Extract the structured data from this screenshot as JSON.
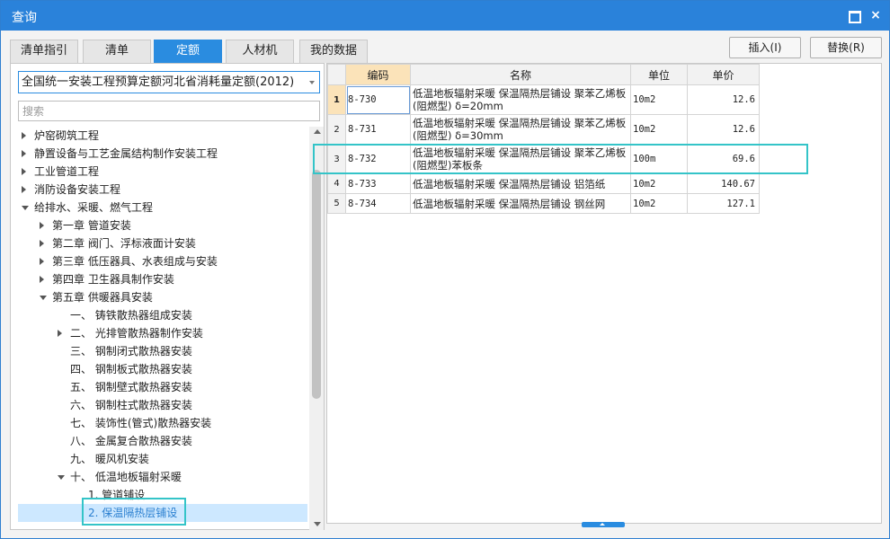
{
  "window": {
    "title": "查询",
    "maximize_icon": "maximize-icon",
    "close_icon": "close-icon",
    "close_glyph": "×"
  },
  "tabs": [
    {
      "label": "清单指引",
      "active": false
    },
    {
      "label": "清单",
      "active": false
    },
    {
      "label": "定额",
      "active": true
    },
    {
      "label": "人材机",
      "active": false
    },
    {
      "label": "我的数据",
      "active": false
    }
  ],
  "buttons": {
    "insert": "插入(I)",
    "replace": "替换(R)"
  },
  "quota_selector": {
    "value": "全国统一安装工程预算定额河北省消耗量定额(2012)"
  },
  "search": {
    "placeholder": "搜索"
  },
  "tree": [
    {
      "label": "炉窑砌筑工程",
      "state": "collapsed",
      "level": 0
    },
    {
      "label": "静置设备与工艺金属结构制作安装工程",
      "state": "collapsed",
      "level": 0
    },
    {
      "label": "工业管道工程",
      "state": "collapsed",
      "level": 0
    },
    {
      "label": "消防设备安装工程",
      "state": "collapsed",
      "level": 0
    },
    {
      "label": "给排水、采暖、燃气工程",
      "state": "expanded",
      "level": 0
    },
    {
      "label": "第一章 管道安装",
      "state": "collapsed",
      "level": 1
    },
    {
      "label": "第二章 阀门、浮标液面计安装",
      "state": "collapsed",
      "level": 1
    },
    {
      "label": "第三章 低压器具、水表组成与安装",
      "state": "collapsed",
      "level": 1
    },
    {
      "label": "第四章 卫生器具制作安装",
      "state": "collapsed",
      "level": 1
    },
    {
      "label": "第五章 供暖器具安装",
      "state": "expanded",
      "level": 1
    },
    {
      "label": "一、 铸铁散热器组成安装",
      "state": "leaf",
      "level": 2
    },
    {
      "label": "二、 光排管散热器制作安装",
      "state": "collapsed",
      "level": 2
    },
    {
      "label": "三、 钢制闭式散热器安装",
      "state": "leaf",
      "level": 2
    },
    {
      "label": "四、 钢制板式散热器安装",
      "state": "leaf",
      "level": 2
    },
    {
      "label": "五、 钢制壁式散热器安装",
      "state": "leaf",
      "level": 2
    },
    {
      "label": "六、 钢制柱式散热器安装",
      "state": "leaf",
      "level": 2
    },
    {
      "label": "七、 装饰性(管式)散热器安装",
      "state": "leaf",
      "level": 2
    },
    {
      "label": "八、 金属复合散热器安装",
      "state": "leaf",
      "level": 2
    },
    {
      "label": "九、 暖风机安装",
      "state": "leaf",
      "level": 2
    },
    {
      "label": "十、 低温地板辐射采暖",
      "state": "expanded",
      "level": 2
    },
    {
      "label": "1. 管道铺设",
      "state": "leaf",
      "level": 3
    },
    {
      "label": "2. 保温隔热层铺设",
      "state": "leaf",
      "level": 3,
      "selected": true
    }
  ],
  "table": {
    "headers": [
      "",
      "编码",
      "名称",
      "单位",
      "单价"
    ],
    "rows": [
      {
        "no": "1",
        "code": "8-730",
        "name": "低温地板辐射采暖 保温隔热层铺设 聚苯乙烯板(阻燃型) δ=20mm",
        "unit": "10m2",
        "price": "12.6",
        "current": true
      },
      {
        "no": "2",
        "code": "8-731",
        "name": "低温地板辐射采暖 保温隔热层铺设 聚苯乙烯板(阻燃型) δ=30mm",
        "unit": "10m2",
        "price": "12.6"
      },
      {
        "no": "3",
        "code": "8-732",
        "name": "低温地板辐射采暖 保温隔热层铺设 聚苯乙烯板(阻燃型)苯板条",
        "unit": "100m",
        "price": "69.6"
      },
      {
        "no": "4",
        "code": "8-733",
        "name": "低温地板辐射采暖 保温隔热层铺设 铝箔纸",
        "unit": "10m2",
        "price": "140.67"
      },
      {
        "no": "5",
        "code": "8-734",
        "name": "低温地板辐射采暖 保温隔热层铺设 钢丝网",
        "unit": "10m2",
        "price": "127.1"
      }
    ]
  },
  "colors": {
    "title_bar": "#2a82da",
    "active_tab": "#2a8ce0",
    "highlight_box": "#34c4c8",
    "code_header": "#fbe3b9",
    "selected_row": "#cde8ff"
  }
}
